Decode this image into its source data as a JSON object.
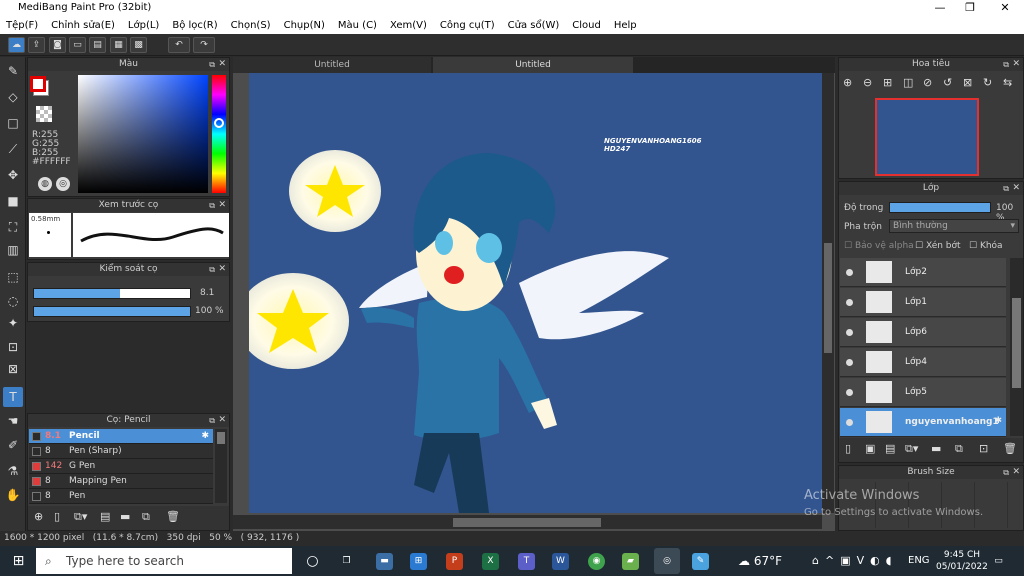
{
  "window": {
    "title": "MediBang Paint Pro (32bit)",
    "minimize": "—",
    "maximize": "❐",
    "close": "✕"
  },
  "menu": [
    "Tệp(F)",
    "Chỉnh sửa(E)",
    "Lớp(L)",
    "Bộ lọc(R)",
    "Chọn(S)",
    "Chụp(N)",
    "Màu (C)",
    "Xem(V)",
    "Công cụ(T)",
    "Cửa sổ(W)",
    "Cloud",
    "Help"
  ],
  "tabs": [
    "Untitled",
    "Untitled"
  ],
  "color_panel": {
    "title": "Màu",
    "r": "R:255",
    "g": "G:255",
    "b": "B:255",
    "hex": "#FFFFFF",
    "primary": "#ff0000",
    "secondary": "#ffffff"
  },
  "preview_panel": {
    "title": "Xem trước cọ",
    "size": "0.58mm"
  },
  "brush_control": {
    "title": "Kiểm soát cọ",
    "size": "8.1",
    "opacity": "100 %",
    "size_fraction": 0.55,
    "opacity_fraction": 1.0
  },
  "brush_panel": {
    "title": "Cọ: Pencil",
    "brushes": [
      {
        "size": "8.1",
        "name": "Pencil",
        "color": "#2b2b2b",
        "selected": true
      },
      {
        "size": "8",
        "name": "Pen (Sharp)",
        "color": "#2b2b2b",
        "selected": false
      },
      {
        "size": "142",
        "name": "G Pen",
        "color": "#e03c3c",
        "selected": false
      },
      {
        "size": "8",
        "name": "Mapping Pen",
        "color": "#e03c3c",
        "selected": false
      },
      {
        "size": "8",
        "name": "Pen",
        "color": "#2b2b2b",
        "selected": false
      }
    ]
  },
  "canvas": {
    "signature_line1": "NGUYENVANHOANG1606",
    "signature_line2": "HD247",
    "background": "#33558f"
  },
  "navigator": {
    "title": "Hoa tiêu"
  },
  "layer_panel": {
    "title": "Lớp",
    "opacity_label": "Độ trong",
    "opacity_value": "100 %",
    "blend_label": "Pha trộn",
    "blend_value": "Bình thường",
    "protect_alpha": "Bảo vệ alpha",
    "clipping": "Xén bớt",
    "lock": "Khóa",
    "layers": [
      {
        "name": "Lớp2",
        "selected": false
      },
      {
        "name": "Lớp1",
        "selected": false
      },
      {
        "name": "Lớp6",
        "selected": false
      },
      {
        "name": "Lớp4",
        "selected": false
      },
      {
        "name": "Lớp5",
        "selected": false
      },
      {
        "name": "nguyenvanhoang1",
        "selected": true
      }
    ]
  },
  "brush_size_panel": {
    "title": "Brush Size"
  },
  "watermark": {
    "line1": "Activate Windows",
    "line2": "Go to Settings to activate Windows."
  },
  "status": {
    "text": "1600 * 1200 pixel   (11.6 * 8.7cm)   350 dpi   50 %   ( 932, 1176 )"
  },
  "taskbar": {
    "search_placeholder": "Type here to search",
    "weather": "67°F",
    "lang": "ENG",
    "time": "9:45 CH",
    "date": "05/01/2022"
  }
}
